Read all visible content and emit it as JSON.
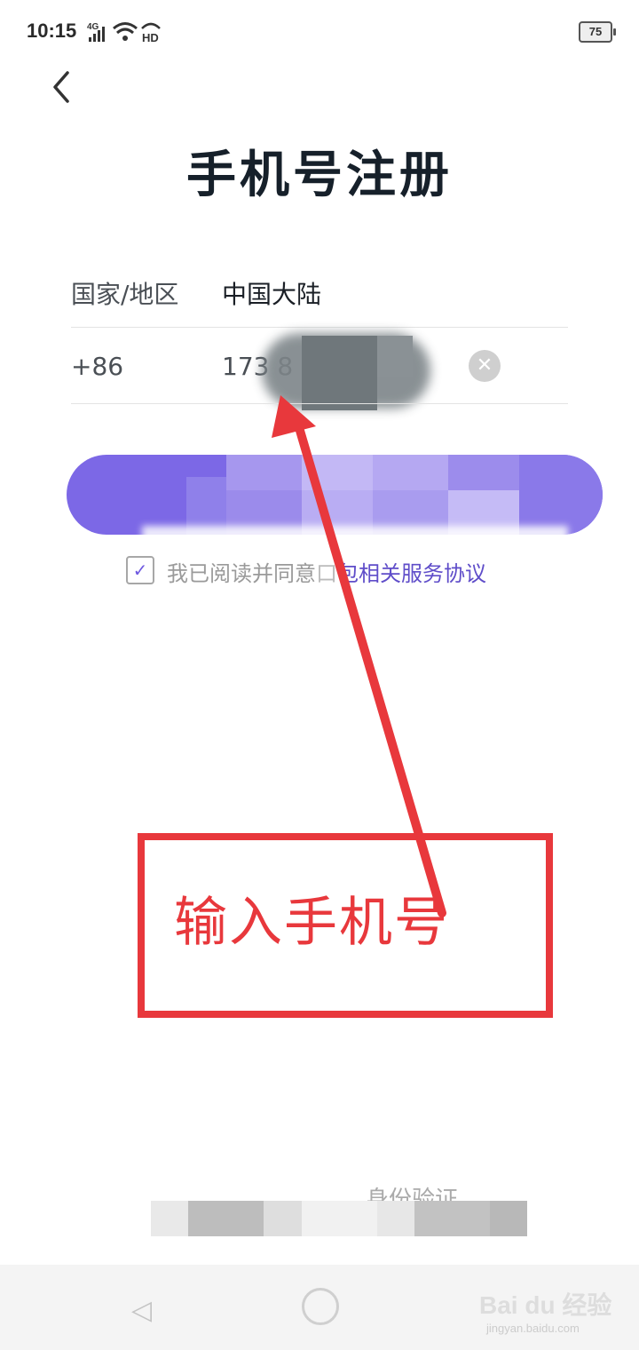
{
  "status_bar": {
    "time": "10:15",
    "network": "4G",
    "hd": "HD",
    "battery": "75"
  },
  "header": {
    "back_icon": "chevron-left-icon",
    "title": "手机号注册"
  },
  "form": {
    "region_label": "国家/地区",
    "region_value": "中国大陆",
    "country_code": "+86",
    "phone_value": "173 8",
    "clear_icon": "clear-circle-icon"
  },
  "agreement": {
    "checked": true,
    "prefix": "我已阅读并同意",
    "link": "包相关服务协议"
  },
  "annotation": {
    "callout_text": "输入手机号",
    "color": "#e8383c"
  },
  "footer": {
    "verify_text": "身份验证"
  },
  "watermark": {
    "brand": "Bai du 经验",
    "url": "jingyan.baidu.com"
  },
  "colors": {
    "accent": "#7c68e6",
    "link": "#5f4dc9"
  }
}
